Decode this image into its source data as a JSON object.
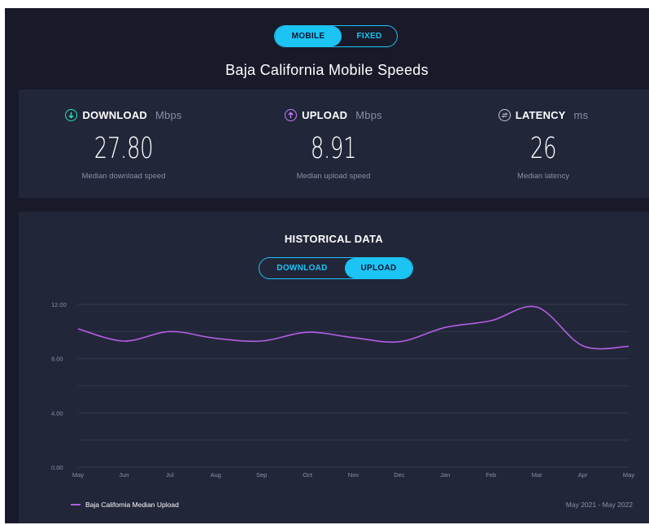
{
  "connection_toggle": {
    "options": [
      "MOBILE",
      "FIXED"
    ],
    "selected": "MOBILE"
  },
  "page_title": "Baja California Mobile Speeds",
  "metrics": {
    "download": {
      "label": "DOWNLOAD",
      "unit": "Mbps",
      "value": "27.80",
      "caption": "Median download speed",
      "color": "#1de9b6",
      "icon": "download-arrow-icon"
    },
    "upload": {
      "label": "UPLOAD",
      "unit": "Mbps",
      "value": "8.91",
      "caption": "Median upload speed",
      "color": "#c77dff",
      "icon": "upload-arrow-icon"
    },
    "latency": {
      "label": "LATENCY",
      "unit": "ms",
      "value": "26",
      "caption": "Median latency",
      "color": "#c9cbd6",
      "icon": "latency-icon"
    }
  },
  "historical": {
    "title": "HISTORICAL DATA",
    "toggle": {
      "options": [
        "DOWNLOAD",
        "UPLOAD"
      ],
      "selected": "UPLOAD"
    },
    "legend_label": "Baja California Median Upload",
    "date_range": "May 2021 - May 2022"
  },
  "chart_data": {
    "type": "line",
    "x": [
      "May",
      "Jun",
      "Jul",
      "Aug",
      "Sep",
      "Oct",
      "Nov",
      "Dec",
      "Jan",
      "Feb",
      "Mar",
      "Apr",
      "May"
    ],
    "series": [
      {
        "name": "Baja California Median Upload",
        "values": [
          10.2,
          9.3,
          10.0,
          9.5,
          9.3,
          9.95,
          9.55,
          9.25,
          10.3,
          10.8,
          11.8,
          8.95,
          8.91
        ],
        "color": "#b25ee3"
      }
    ],
    "y_ticks": [
      "12.00",
      "8.00",
      "4.00",
      "0.00"
    ],
    "ylim": [
      0,
      12
    ],
    "grid": true
  }
}
